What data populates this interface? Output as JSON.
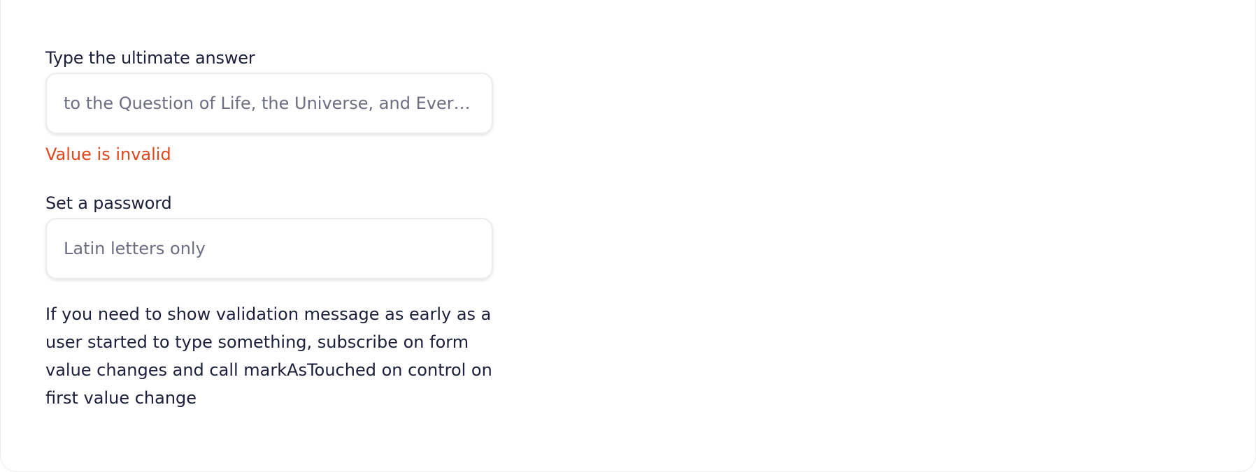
{
  "form": {
    "answer_field": {
      "label": "Type the ultimate answer",
      "placeholder": "to the Question of Life, the Universe, and Everything",
      "value": "",
      "error": "Value is invalid"
    },
    "password_field": {
      "label": "Set a password",
      "placeholder": "Latin letters only",
      "value": ""
    },
    "help_text": "If you need to show validation message as early as a user started to type something, subscribe on form value changes and call markAsTouched on control on first value change"
  },
  "colors": {
    "text": "#1b1f3b",
    "placeholder": "#6b6e82",
    "error": "#e0461b",
    "border": "#ececef"
  }
}
